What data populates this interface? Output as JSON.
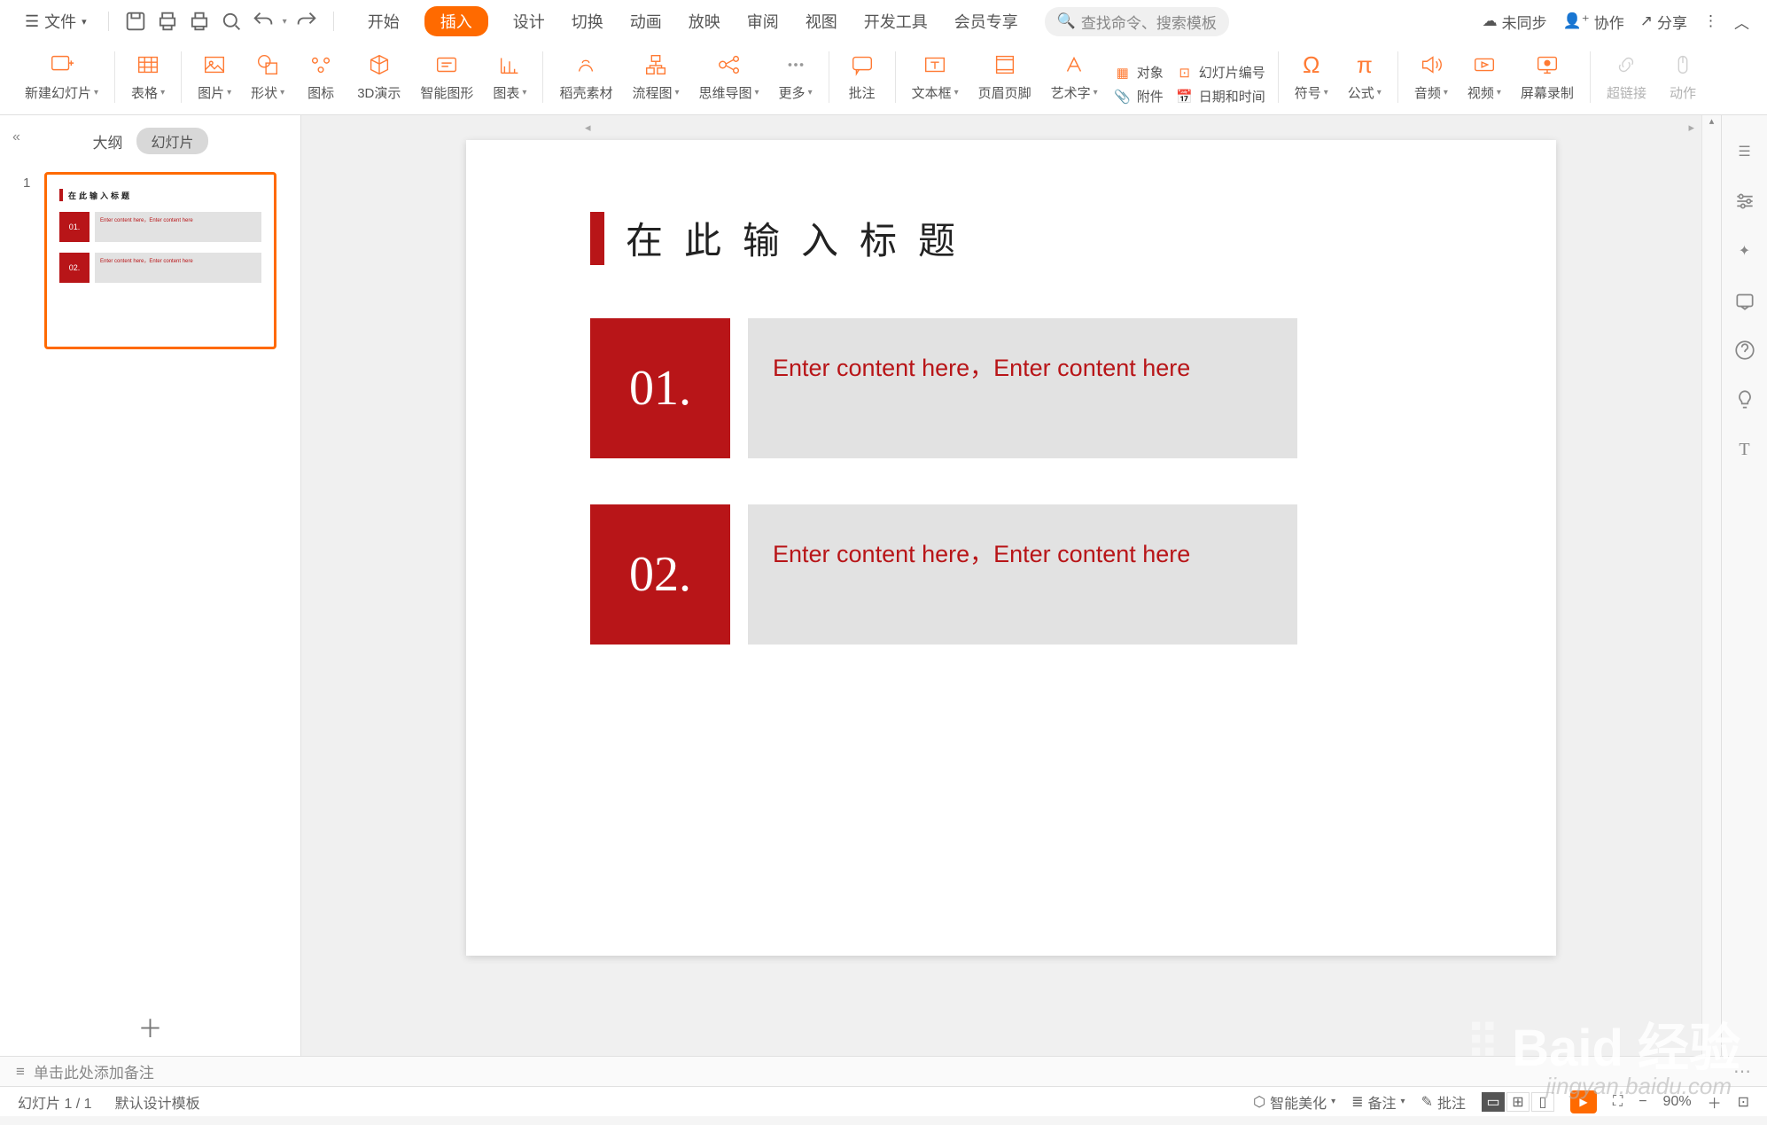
{
  "topbar": {
    "file_label": "文件",
    "sync_label": "未同步",
    "collab_label": "协作",
    "share_label": "分享",
    "search_placeholder": "查找命令、搜索模板",
    "tabs": [
      "开始",
      "插入",
      "设计",
      "切换",
      "动画",
      "放映",
      "审阅",
      "视图",
      "开发工具",
      "会员专享"
    ],
    "active_tab_index": 1
  },
  "ribbon": {
    "new_slide": "新建幻灯片",
    "table": "表格",
    "picture": "图片",
    "shape": "形状",
    "icon_lib": "图标",
    "presentation_3d": "3D演示",
    "smart_graphic": "智能图形",
    "chart": "图表",
    "docer": "稻壳素材",
    "flowchart": "流程图",
    "mindmap": "思维导图",
    "more": "更多",
    "comment": "批注",
    "textbox": "文本框",
    "header_footer": "页眉页脚",
    "wordart": "艺术字",
    "object": "对象",
    "slide_number": "幻灯片编号",
    "attachment": "附件",
    "date_time": "日期和时间",
    "symbol": "符号",
    "formula": "公式",
    "audio": "音频",
    "video": "视频",
    "screen_record": "屏幕录制",
    "hyperlink": "超链接",
    "action": "动作"
  },
  "slide_panel": {
    "outline": "大纲",
    "slides": "幻灯片",
    "thumb_title": "在此输入标题",
    "thumb_num_1": "01.",
    "thumb_num_2": "02.",
    "thumb_text": "Enter content here，Enter content here",
    "slide_index": "1"
  },
  "canvas": {
    "title": "在此输入标题",
    "items": [
      {
        "num": "01.",
        "text": "Enter content here，Enter content here"
      },
      {
        "num": "02.",
        "text": "Enter content here，Enter content here"
      }
    ]
  },
  "notes": {
    "placeholder": "单击此处添加备注"
  },
  "status": {
    "slide_counter": "幻灯片 1 / 1",
    "template": "默认设计模板",
    "beautify": "智能美化",
    "notes_btn": "备注",
    "comments_btn": "批注",
    "zoom": "90%"
  },
  "watermark": {
    "main": "Baid 经验",
    "sub": "jingyan.baidu.com"
  },
  "colors": {
    "accent": "#ff6a00",
    "brand_red": "#b81518"
  }
}
